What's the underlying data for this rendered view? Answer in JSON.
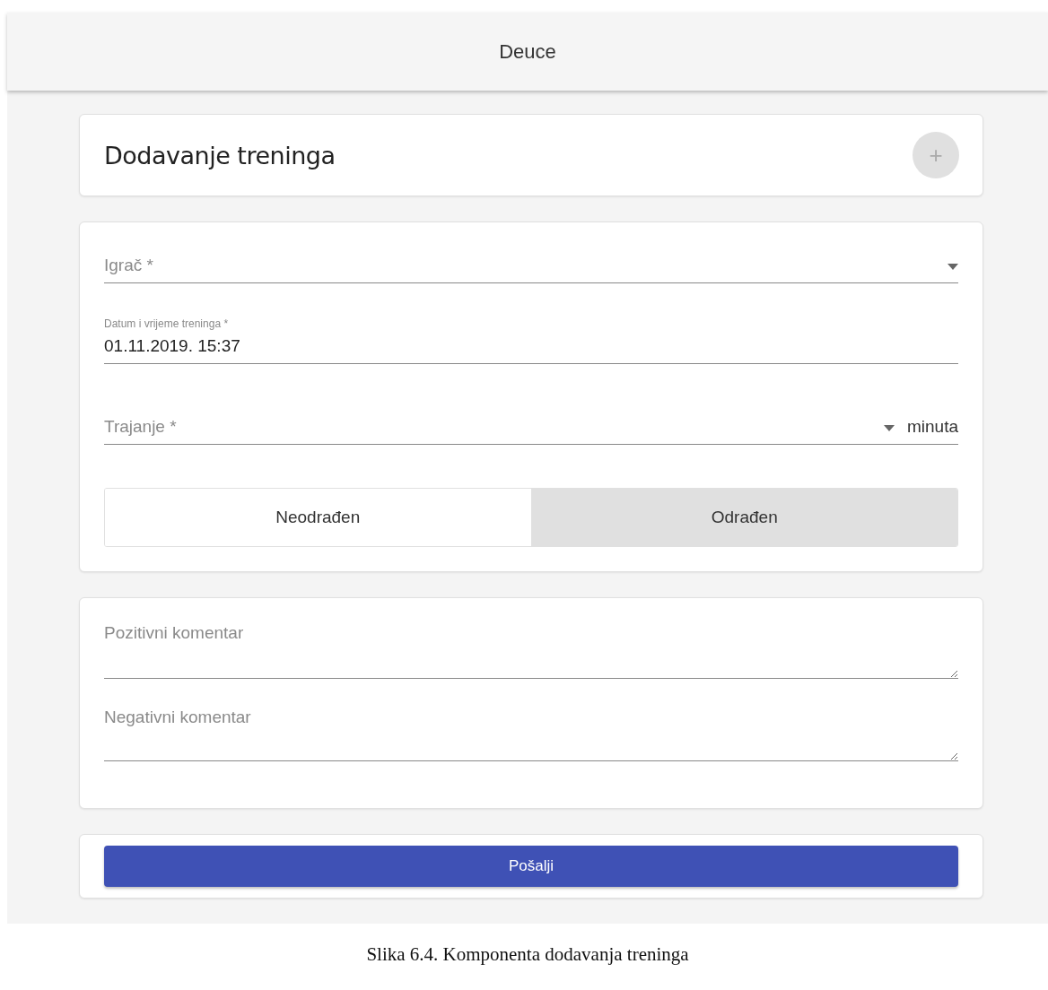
{
  "header": {
    "title": "Deuce"
  },
  "title_card": {
    "title": "Dodavanje treninga",
    "add_button": "+"
  },
  "fields": [
    {
      "kind": "select",
      "placeholder": "Igrač *"
    },
    {
      "kind": "date",
      "label": "Datum i vrijeme treninga *",
      "value": "01.11.2019. 15:37"
    },
    {
      "kind": "number",
      "placeholder": "Trajanje *",
      "suffix": "minuta"
    }
  ],
  "status_toggle": [
    {
      "label": "Neodrađen",
      "selected": false
    },
    {
      "label": "Odrađen",
      "selected": true
    }
  ],
  "comments": [
    {
      "placeholder": "Pozitivni komentar"
    },
    {
      "placeholder": "Negativni komentar"
    }
  ],
  "submit": {
    "label": "Pošalji"
  },
  "caption": "Slika 6.4. Komponenta dodavanja treninga"
}
